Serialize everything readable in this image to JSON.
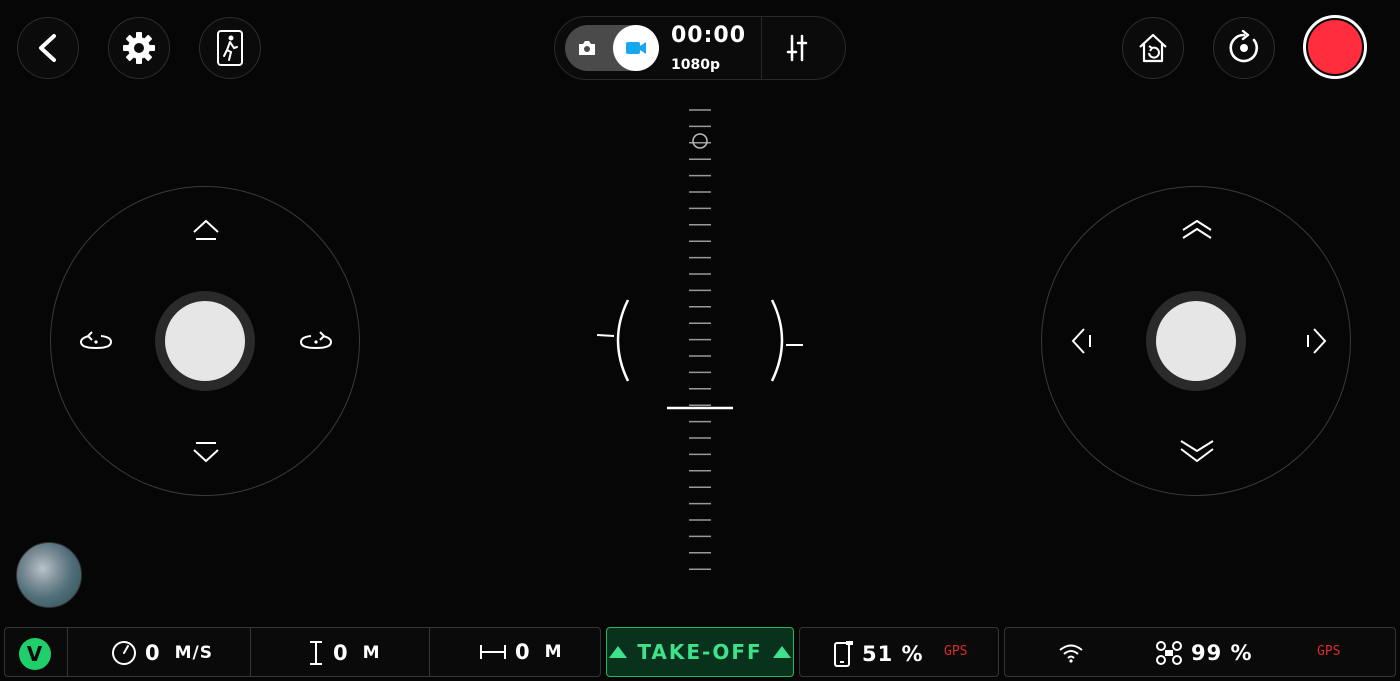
{
  "header": {
    "back_icon": "chevron-left-icon",
    "settings_icon": "gear-icon",
    "follow_icon": "walking-person-icon",
    "mode": {
      "photo_icon": "camera-icon",
      "video_icon": "video-camera-icon",
      "selected": "video"
    },
    "timer": "00:00",
    "resolution": "1080p",
    "adjust_icon": "sliders-icon",
    "home_icon": "return-home-icon",
    "rotate_icon": "rotate-icon",
    "record_color": "#ff2d3d"
  },
  "joysticks": {
    "left": {
      "arrows": [
        "ascend",
        "rotate-left",
        "rotate-right",
        "descend"
      ]
    },
    "right": {
      "arrows": [
        "forward",
        "left",
        "right",
        "backward"
      ]
    }
  },
  "status": {
    "speed": {
      "value": "0",
      "unit": "M/S"
    },
    "altitude": {
      "value": "0",
      "unit": "M"
    },
    "distance": {
      "value": "0",
      "unit": "M"
    },
    "takeoff_label": "TAKE-OFF",
    "phone_battery": "51 %",
    "phone_gps": "GPS",
    "drone_battery": "99 %",
    "drone_gps": "GPS",
    "v_badge": "V"
  },
  "colors": {
    "accent_green": "#1fd06a",
    "record_red": "#ff2d3d",
    "gps_red": "#e02a2a"
  }
}
